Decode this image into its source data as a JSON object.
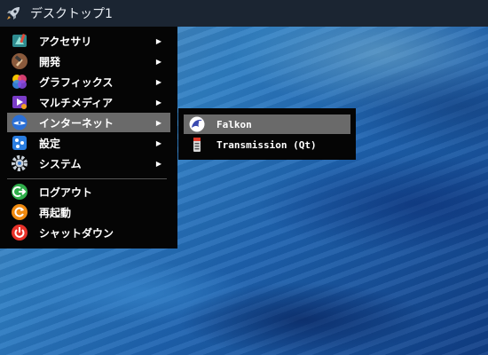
{
  "taskbar": {
    "desktop_label": "デスクトップ1",
    "launcher_icon": "rocket-icon"
  },
  "menu": {
    "items": [
      {
        "label": "アクセサリ",
        "icon": "accessories-icon",
        "has_submenu": true
      },
      {
        "label": "開発",
        "icon": "hammer-icon",
        "has_submenu": true
      },
      {
        "label": "グラフィックス",
        "icon": "graphics-icon",
        "has_submenu": true
      },
      {
        "label": "マルチメディア",
        "icon": "multimedia-icon",
        "has_submenu": true
      },
      {
        "label": "インターネット",
        "icon": "internet-icon",
        "has_submenu": true,
        "selected": true
      },
      {
        "label": "設定",
        "icon": "settings-icon",
        "has_submenu": true
      },
      {
        "label": "システム",
        "icon": "system-gear-icon",
        "has_submenu": true
      }
    ],
    "actions": [
      {
        "label": "ログアウト",
        "icon": "logout-icon"
      },
      {
        "label": "再起動",
        "icon": "restart-icon"
      },
      {
        "label": "シャットダウン",
        "icon": "power-icon"
      }
    ],
    "submenu_arrow": "▶"
  },
  "submenu": {
    "items": [
      {
        "label": "Falkon",
        "icon": "falkon-icon",
        "selected": true
      },
      {
        "label": "Transmission (Qt)",
        "icon": "transmission-icon"
      }
    ]
  },
  "colors": {
    "menu_bg": "#050505",
    "selection": "#6a6a6a",
    "taskbar": "#1b2532"
  }
}
